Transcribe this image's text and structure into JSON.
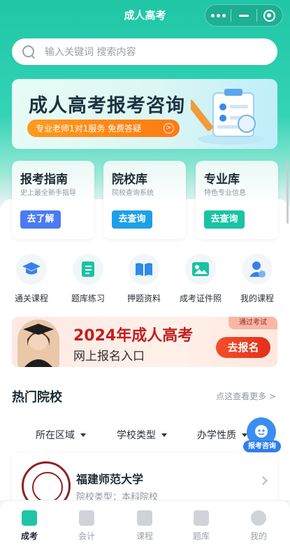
{
  "titlebar": {
    "title": "成人高考"
  },
  "search": {
    "placeholder": "输入关键词 搜索内容"
  },
  "banner": {
    "title": "成人高考报考咨询",
    "pill_text": "专业老师1对1服务 免费答疑",
    "arrow": ">"
  },
  "cards": [
    {
      "title": "报考指南",
      "subtitle": "史上最全新手指导",
      "button": "去了解",
      "color": "#4a7bf0"
    },
    {
      "title": "院校库",
      "subtitle": "院校查询系统",
      "button": "去查询",
      "color": "#1ea0e8"
    },
    {
      "title": "专业库",
      "subtitle": "特色专业信息",
      "button": "去查询",
      "color": "#19c3a3"
    }
  ],
  "quick": [
    {
      "label": "通关课程",
      "icon": "graduation-cap-icon"
    },
    {
      "label": "题库练习",
      "icon": "question-book-icon"
    },
    {
      "label": "押题资料",
      "icon": "open-book-icon"
    },
    {
      "label": "成考证件照",
      "icon": "photo-icon"
    },
    {
      "label": "我的课程",
      "icon": "user-course-icon"
    }
  ],
  "promo": {
    "title": "2024年成人高考",
    "subtitle": "网上报名入口",
    "tag": "通过考试",
    "button": "去报名"
  },
  "hot": {
    "title": "热门院校",
    "more": "点这查看更多 >",
    "filters": [
      "所在区域",
      "学校类型",
      "办学性质"
    ],
    "school": {
      "name": "福建师范大学",
      "type": "院校类型：本科院校"
    }
  },
  "float_consult": {
    "label": "报考咨询"
  },
  "tabbar": [
    {
      "label": "成考",
      "active": true
    },
    {
      "label": "会计",
      "active": false
    },
    {
      "label": "课程",
      "active": false
    },
    {
      "label": "题库",
      "active": false
    },
    {
      "label": "我的",
      "active": false
    }
  ],
  "colors": {
    "brand": "#1fc6a6",
    "promo_red": "#c41f1f",
    "orange": "#ff8a18"
  }
}
